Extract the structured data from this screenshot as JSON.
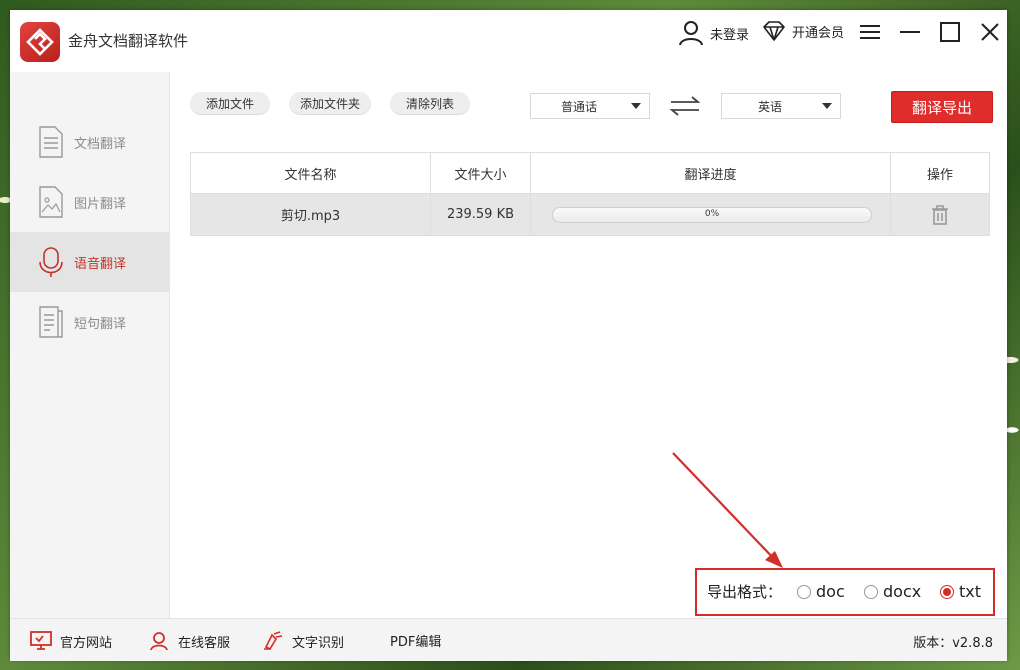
{
  "app": {
    "title": "金舟文档翻译软件"
  },
  "header": {
    "login_label": "未登录",
    "vip_label": "开通会员"
  },
  "sidebar": {
    "items": [
      {
        "label": "文档翻译",
        "icon": "document-icon",
        "active": false
      },
      {
        "label": "图片翻译",
        "icon": "image-icon",
        "active": false
      },
      {
        "label": "语音翻译",
        "icon": "microphone-icon",
        "active": true
      },
      {
        "label": "短句翻译",
        "icon": "text-icon",
        "active": false
      }
    ]
  },
  "toolbar": {
    "add_file": "添加文件",
    "add_folder": "添加文件夹",
    "clear_list": "清除列表",
    "source_lang": "普通话",
    "target_lang": "英语",
    "translate_export": "翻译导出"
  },
  "table": {
    "columns": [
      "文件名称",
      "文件大小",
      "翻译进度",
      "操作"
    ],
    "rows": [
      {
        "name": "剪切.mp3",
        "size": "239.59 KB",
        "progress_text": "0%",
        "progress": 0
      }
    ]
  },
  "export": {
    "label": "导出格式：",
    "options": [
      {
        "label": "doc",
        "selected": false
      },
      {
        "label": "docx",
        "selected": false
      },
      {
        "label": "txt",
        "selected": true
      }
    ]
  },
  "footer": {
    "website": "官方网站",
    "support": "在线客服",
    "ocr": "文字识别",
    "pdf": "PDF编辑",
    "version": "版本：v2.8.8"
  },
  "colors": {
    "accent": "#de2d2a",
    "active_nav_bg": "#e4e4e4",
    "annotation_red": "#d42d28"
  }
}
